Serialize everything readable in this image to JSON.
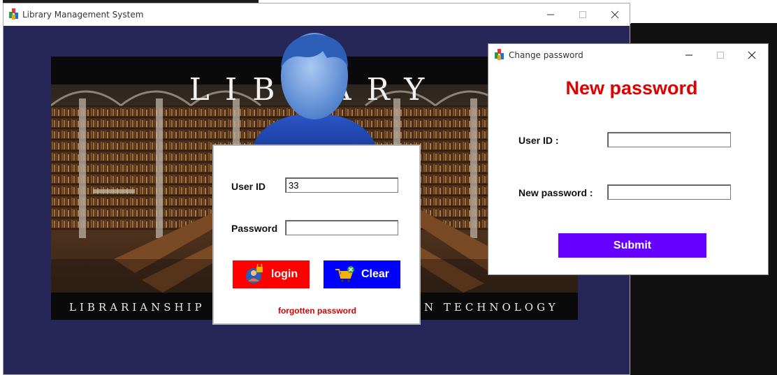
{
  "main_window": {
    "title": "Library Management System"
  },
  "banner": {
    "title": "LIBRARY",
    "subtitle_left": "LIBRARIANSHIP",
    "subtitle_right": "N TECHNOLOGY"
  },
  "login": {
    "user_id_label": "User ID",
    "user_id_value": "33",
    "password_label": "Password",
    "password_value": "",
    "login_button": "login",
    "clear_button": "Clear",
    "forgot_link": "forgotten password"
  },
  "change_password": {
    "title": "Change password",
    "heading": "New password",
    "user_id_label": "User ID :",
    "user_id_value": "",
    "new_password_label": "New password :",
    "new_password_value": "",
    "submit_button": "Submit"
  },
  "colors": {
    "window_bg": "#262659",
    "login_button": "#ff0000",
    "clear_button": "#0000ff",
    "submit_button": "#6600ff",
    "heading": "#e00000",
    "forgot_link": "#d40000"
  },
  "icons": {
    "app": "app-icon",
    "login": "user-lock-icon",
    "clear": "cart-remove-icon",
    "avatar": "user-avatar-icon"
  }
}
